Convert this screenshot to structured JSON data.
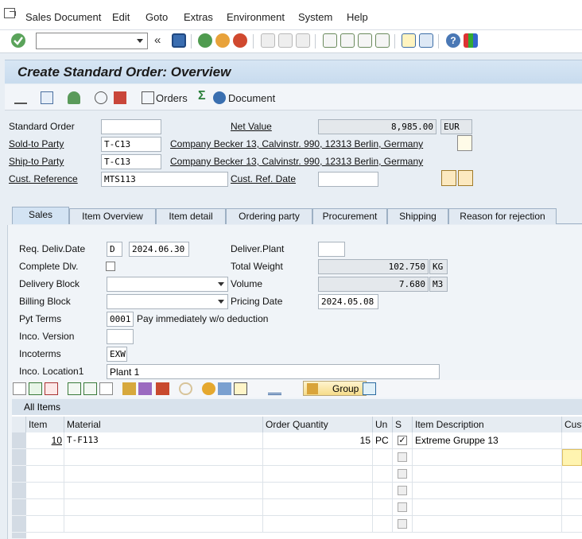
{
  "menu": {
    "items": [
      "Sales Document",
      "Edit",
      "Goto",
      "Extras",
      "Environment",
      "System",
      "Help"
    ]
  },
  "toolbar": {
    "command_field": ""
  },
  "title": "Create Standard Order: Overview",
  "app_toolbar": {
    "orders_label": "Orders",
    "document_label": "Document"
  },
  "header": {
    "standard_order_label": "Standard Order",
    "standard_order_value": "",
    "net_value_label": "Net Value",
    "net_value": "8,985.00",
    "currency": "EUR",
    "sold_to_label": "Sold-to Party",
    "sold_to_value": "T-C13",
    "sold_to_text": "Company Becker 13, Calvinstr. 990, 12313 Berlin, Germany",
    "ship_to_label": "Ship-to Party",
    "ship_to_value": "T-C13",
    "ship_to_text": "Company Becker 13, Calvinstr. 990, 12313 Berlin, Germany",
    "cust_ref_label": "Cust. Reference",
    "cust_ref_value": "MTS113",
    "cust_ref_date_label": "Cust. Ref. Date",
    "cust_ref_date_value": ""
  },
  "tabs": [
    "Sales",
    "Item Overview",
    "Item detail",
    "Ordering party",
    "Procurement",
    "Shipping",
    "Reason for rejection"
  ],
  "sales": {
    "req_deliv_date_label": "Req. Deliv.Date",
    "req_deliv_date_type": "D",
    "req_deliv_date": "2024.06.30",
    "deliver_plant_label": "Deliver.Plant",
    "deliver_plant": "",
    "complete_dlv_label": "Complete Dlv.",
    "total_weight_label": "Total Weight",
    "total_weight": "102.750",
    "weight_unit": "KG",
    "delivery_block_label": "Delivery Block",
    "delivery_block": "",
    "volume_label": "Volume",
    "volume": "7.680",
    "volume_unit": "M3",
    "billing_block_label": "Billing Block",
    "billing_block": "",
    "pricing_date_label": "Pricing Date",
    "pricing_date": "2024.05.08",
    "pyt_terms_label": "Pyt Terms",
    "pyt_terms": "0001",
    "pyt_terms_text": "Pay immediately w/o deduction",
    "inco_version_label": "Inco. Version",
    "inco_version": "",
    "incoterms_label": "Incoterms",
    "incoterms": "EXW",
    "inco_location_label": "Inco. Location1",
    "inco_location": "Plant 1"
  },
  "table_toolbar": {
    "group_label": "Group"
  },
  "items_table": {
    "title": "All Items",
    "columns": [
      "Item",
      "Material",
      "Order Quantity",
      "Un",
      "S",
      "Item Description",
      "Cust"
    ],
    "rows": [
      {
        "item": "10",
        "material": "T-F113",
        "qty": "15",
        "unit": "PC",
        "desc": "Extreme Gruppe 13"
      }
    ]
  }
}
